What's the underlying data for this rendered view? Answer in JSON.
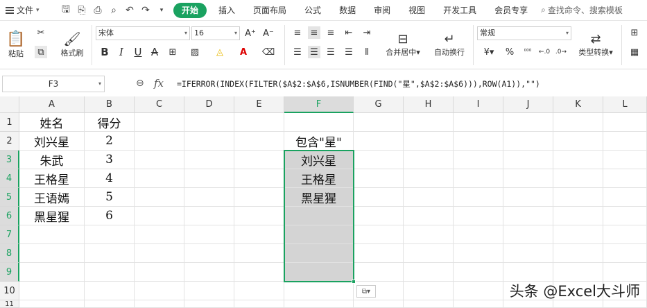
{
  "menubar": {
    "file_label": "文件",
    "tabs": [
      "开始",
      "插入",
      "页面布局",
      "公式",
      "数据",
      "审阅",
      "视图",
      "开发工具",
      "会员专享"
    ],
    "search_label": "查找命令、搜索模板",
    "accent_color": "#1aa260"
  },
  "ribbon": {
    "paste_label": "粘贴",
    "format_painter_label": "格式刷",
    "font_name": "宋体",
    "font_size": "16",
    "merge_label": "合并居中",
    "wrap_label": "自动换行",
    "number_format": "常规",
    "currency_symbol": "¥",
    "percent_symbol": "%",
    "convert_label": "类型转换"
  },
  "formula_bar": {
    "cell_ref": "F3",
    "fx_label": "fx",
    "formula": "=IFERROR(INDEX(FILTER($A$2:$A$6,ISNUMBER(FIND(\"星\",$A$2:$A$6))),ROW(A1)),\"\")"
  },
  "sheet": {
    "columns": [
      "A",
      "B",
      "C",
      "D",
      "E",
      "F",
      "G",
      "H",
      "I",
      "J",
      "K",
      "L"
    ],
    "selected_column": "F",
    "rows": [
      "1",
      "2",
      "3",
      "4",
      "5",
      "6",
      "7",
      "8",
      "9",
      "10",
      "11"
    ],
    "cells": {
      "A1": "姓名",
      "B1": "得分",
      "A2": "刘兴星",
      "B2": "2",
      "A3": "朱武",
      "B3": "3",
      "A4": "王格星",
      "B4": "4",
      "A5": "王语嫣",
      "B5": "5",
      "A6": "黑星猩",
      "B6": "6",
      "F2": "包含\"星\"",
      "F3": "刘兴星",
      "F4": "王格星",
      "F5": "黑星猩"
    }
  },
  "watermark": "头条 @Excel大斗师"
}
